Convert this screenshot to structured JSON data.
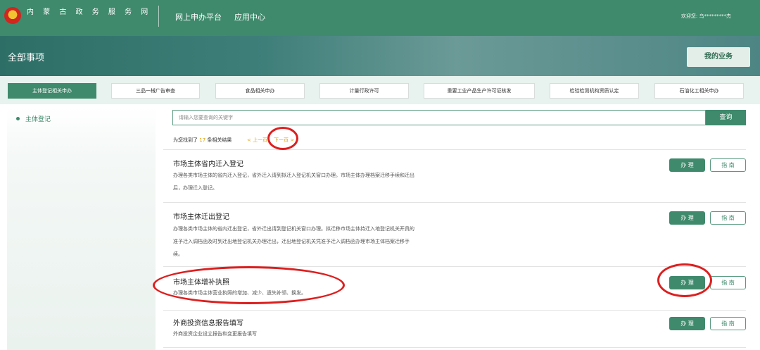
{
  "header": {
    "site_name": "内 蒙 古 政 务 服 务 网",
    "nav": [
      "网上申办平台",
      "应用中心"
    ],
    "user_greeting": "欢迎您: 乌*********杰"
  },
  "banner": {
    "title": "全部事项",
    "my_business_label": "我的业务"
  },
  "tabs": [
    {
      "label": "主体登记相关申办",
      "active": true
    },
    {
      "label": "三品一械广告审查",
      "active": false
    },
    {
      "label": "食品相关申办",
      "active": false
    },
    {
      "label": "计量行政许可",
      "active": false
    },
    {
      "label": "重要工业产品生产许可证核发",
      "active": false
    },
    {
      "label": "检验检测机构资质认定",
      "active": false
    },
    {
      "label": "石油化工相关申办",
      "active": false
    }
  ],
  "sidebar": {
    "items": [
      {
        "label": "主体登记"
      }
    ]
  },
  "search": {
    "placeholder": "请输入您要查询的关键字",
    "button_label": "查询"
  },
  "results": {
    "prefix": "为您找到了",
    "count": "17",
    "suffix": "条相关结果",
    "prev_label": "< 上一页",
    "next_label": "下一页 >"
  },
  "items": [
    {
      "title": "市场主体省内迁入登记",
      "desc": "办理各类市场主体的省内迁入登记，省外迁入请到拟迁入登记机关窗口办理。市场主体办理档案迁移手续和迁出后，办理迁入登记。",
      "do_label": "办 理",
      "guide_label": "指 南"
    },
    {
      "title": "市场主体迁出登记",
      "desc": "办理各类市场主体的省内迁出登记，省外迁出请到登记机关窗口办理。拟迁移市场主体持迁入地登记机关开具的准予迁入调档函及时到迁出地登记机关办理迁出，迁出地登记机关凭准予迁入调档函办理市场主体档案迁移手续。",
      "do_label": "办 理",
      "guide_label": "指 南"
    },
    {
      "title": "市场主体增补执照",
      "desc": "办理各类市场主体营业执照的增加、减少、遗失补领、换发。",
      "do_label": "办 理",
      "guide_label": "指 南"
    },
    {
      "title": "外商投资信息报告填写",
      "desc": "外商投资企业设立报告和变更报告填写",
      "do_label": "办 理",
      "guide_label": "指 南"
    }
  ],
  "colors": {
    "primary": "#3f8a6c",
    "highlight": "#e0a000",
    "annotation": "#dd1f1f"
  }
}
